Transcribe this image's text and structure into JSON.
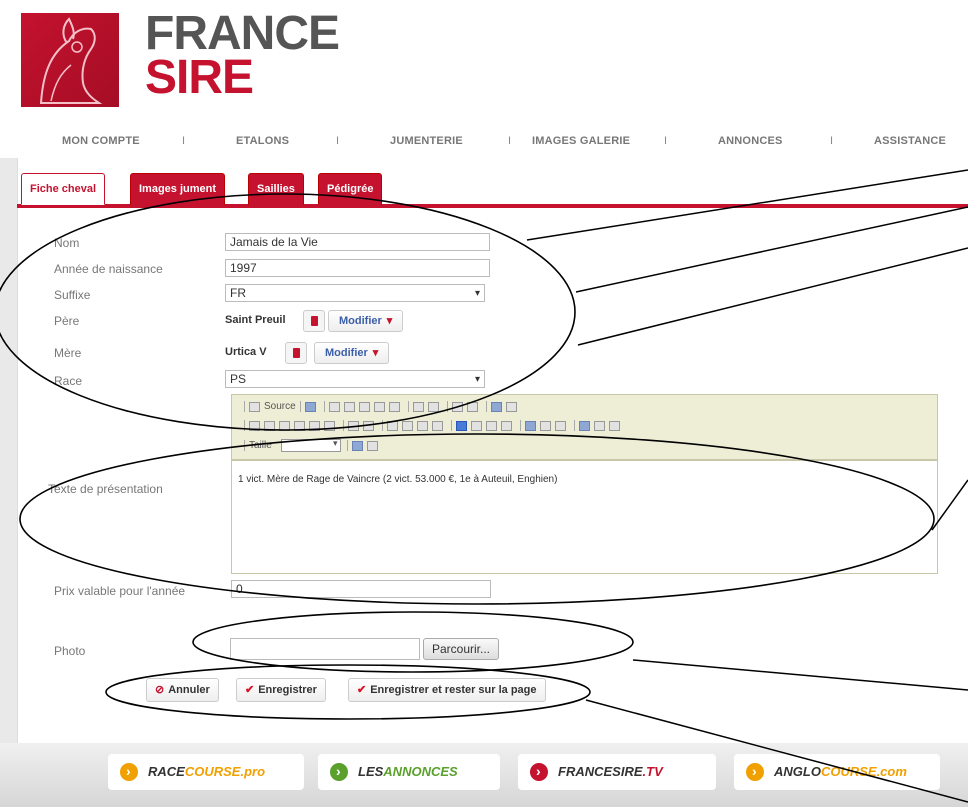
{
  "logo": {
    "line1": "FRANCE",
    "line2": "SIRE"
  },
  "nav": [
    "MON COMPTE",
    "ETALONS",
    "JUMENTERIE",
    "IMAGES GALERIE",
    "ANNONCES",
    "ASSISTANCE"
  ],
  "tabs": [
    "Fiche cheval",
    "Images jument",
    "Saillies",
    "Pédigrée"
  ],
  "form": {
    "nom_label": "Nom",
    "nom_value": "Jamais de la Vie",
    "annee_label": "Année de naissance",
    "annee_value": "1997",
    "suffixe_label": "Suffixe",
    "suffixe_value": "FR",
    "pere_label": "Père",
    "pere_value": "Saint Preuil",
    "mere_label": "Mère",
    "mere_value": "Urtica V",
    "modifier_label": "Modifier",
    "race_label": "Race",
    "race_value": "PS",
    "texte_label": "Texte de présentation",
    "texte_value": "1 vict. Mère de Rage de Vaincre (2 vict. 53.000 €, 1e à Auteuil, Enghien)",
    "prix_label": "Prix valable pour l'année",
    "prix_value": "0",
    "photo_label": "Photo",
    "browse_label": "Parcourir..."
  },
  "editor": {
    "source_label": "Source",
    "taille_label": "Taille"
  },
  "actions": {
    "cancel": "Annuler",
    "save": "Enregistrer",
    "save_stay": "Enregistrer et rester sur la page"
  },
  "footer": [
    {
      "a": "RACE",
      "b": "COURSE.pro",
      "color_a": "#333333",
      "color_b": "#f0a000",
      "dot": "#f0a000"
    },
    {
      "a": "LES",
      "b": "ANNONCES",
      "color_a": "#333333",
      "color_b": "#5aa02c",
      "dot": "#5aa02c"
    },
    {
      "a": "FRANCESIRE",
      "b": ".TV",
      "color_a": "#333333",
      "color_b": "#c4122f",
      "dot": "#c4122f"
    },
    {
      "a": "ANGLO",
      "b": "COURSE.com",
      "color_a": "#333333",
      "color_b": "#f0a000",
      "dot": "#f0a000"
    }
  ],
  "colors": {
    "brand_red": "#c4122f",
    "link_blue": "#3b5ea8"
  }
}
